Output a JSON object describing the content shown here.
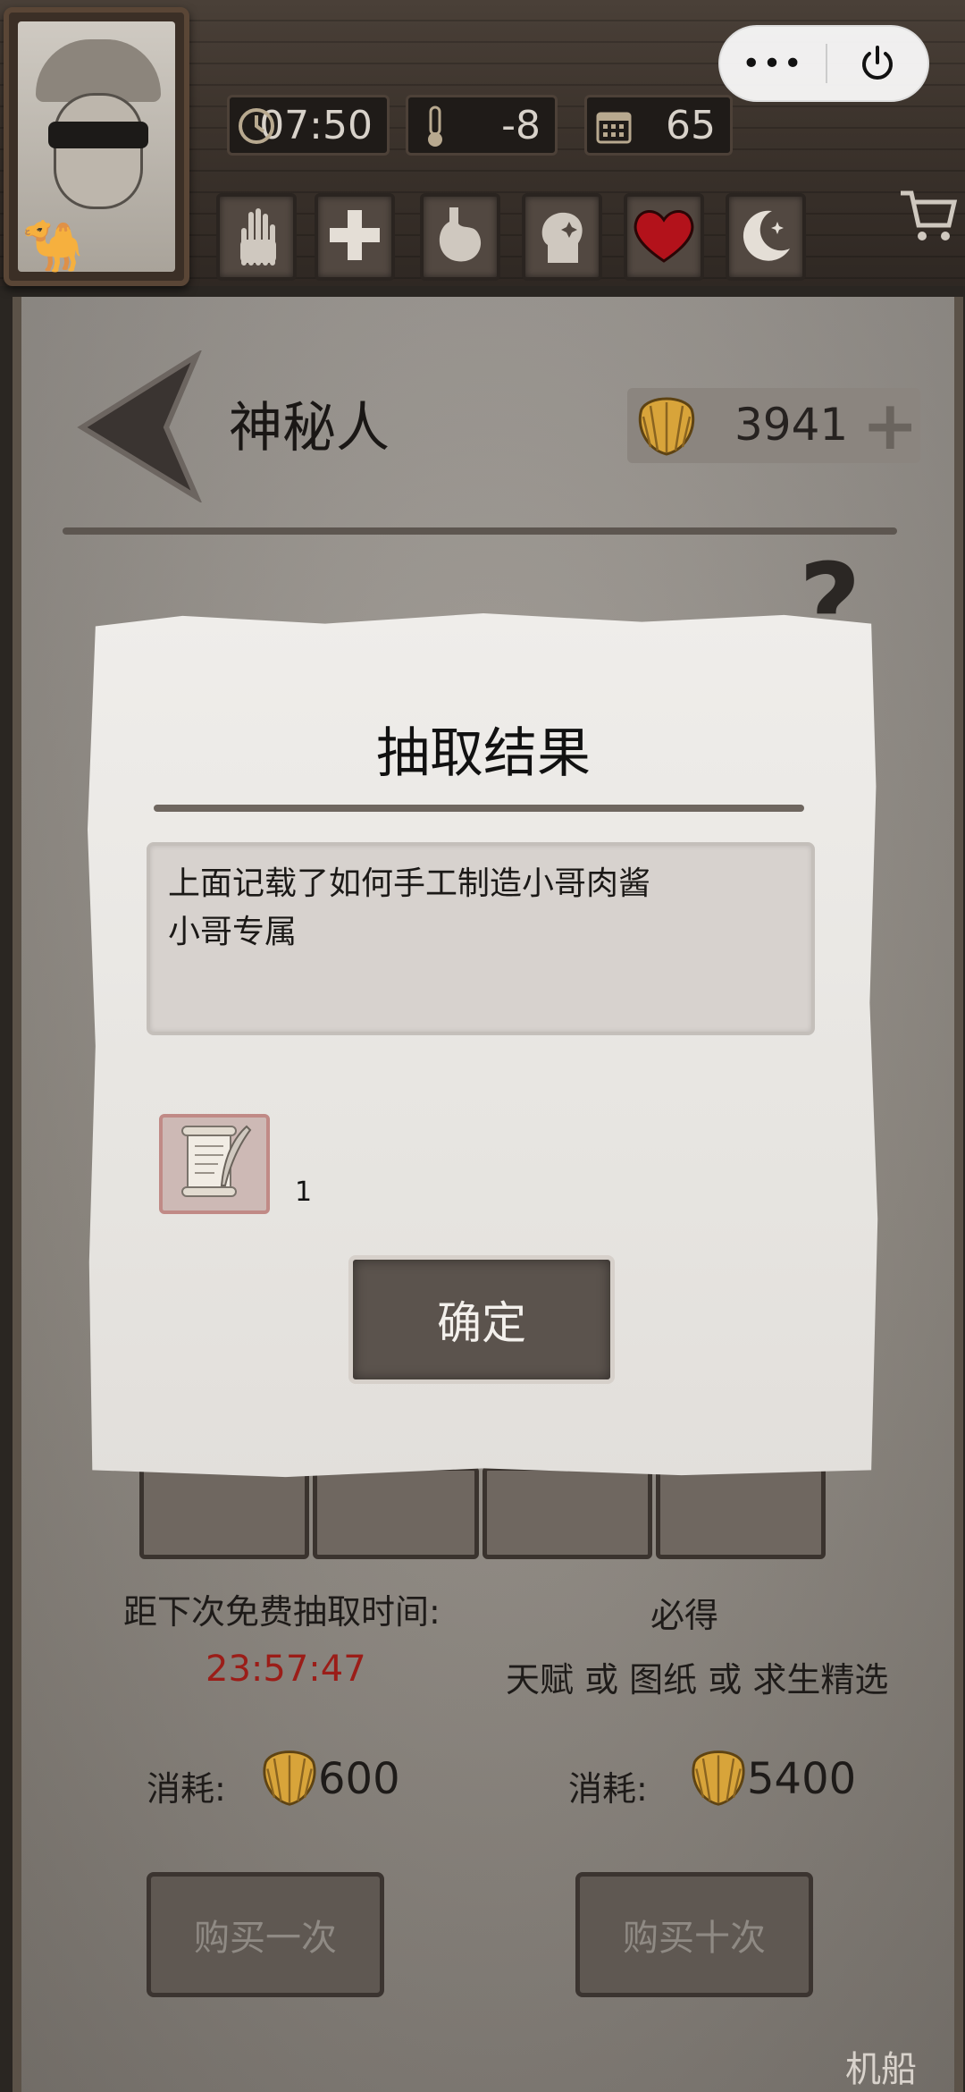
{
  "status": {
    "time": "07:50",
    "temperature": "-8",
    "day": "65"
  },
  "mini_program": {
    "menu_icon": "more-dots-icon",
    "close_icon": "power-icon"
  },
  "abilities": [
    {
      "icon": "bandaged-hand-icon"
    },
    {
      "icon": "medical-cross-icon"
    },
    {
      "icon": "stomach-icon"
    },
    {
      "icon": "head-sparkle-icon"
    },
    {
      "icon": "heart-icon"
    },
    {
      "icon": "moon-star-icon"
    }
  ],
  "header": {
    "title": "神秘人",
    "currency_amount": "3941"
  },
  "modal": {
    "title": "抽取结果",
    "description_lines": [
      "上面记载了如何手工制造小哥肉酱",
      "小哥专属"
    ],
    "item_icon": "scroll-quill-icon",
    "item_count": "1",
    "confirm_label": "确定"
  },
  "draw": {
    "free_label": "距下次免费抽取时间:",
    "timer": "23:57:47",
    "guarantee_label": "必得",
    "guarantee_pool": "天赋 或 图纸 或 求生精选",
    "single": {
      "cost_label": "消耗:",
      "cost": "600",
      "buy_label": "购买一次"
    },
    "ten": {
      "cost_label": "消耗:",
      "cost": "5400",
      "buy_label": "购买十次"
    }
  },
  "footer_text": "机船",
  "colors": {
    "timer_red": "#9b1d18",
    "heart_red": "#b3121b",
    "shell_gold": "#d8a43a"
  }
}
